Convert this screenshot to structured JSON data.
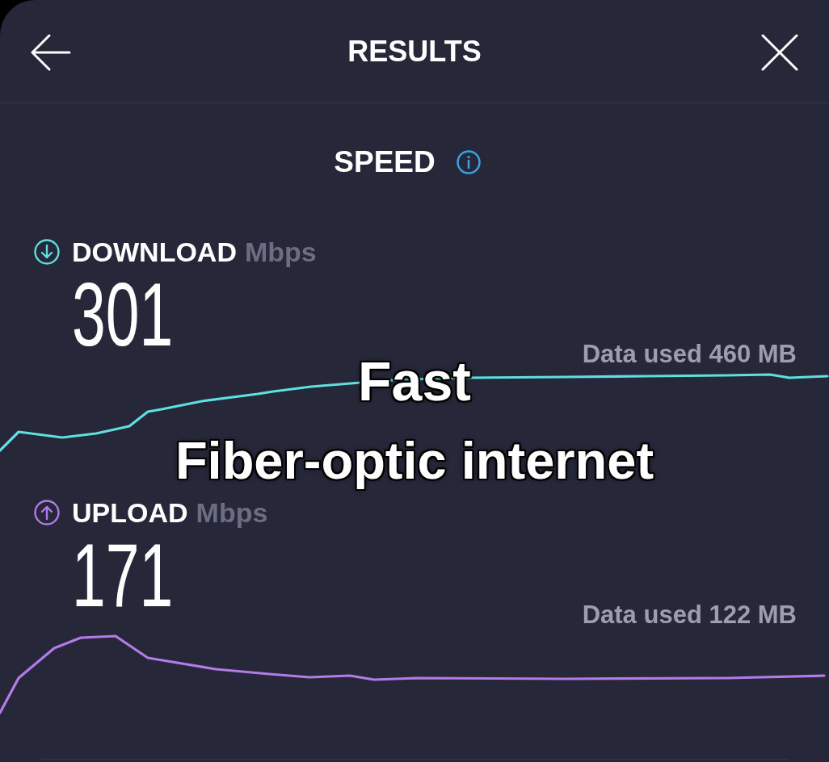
{
  "header": {
    "title": "RESULTS"
  },
  "section": {
    "title": "SPEED"
  },
  "metrics": [
    {
      "kind": "download",
      "label": "DOWNLOAD",
      "unit": "Mbps",
      "value": "301",
      "data_used": "Data used 460 MB",
      "color": "#5fdfe0"
    },
    {
      "kind": "upload",
      "label": "UPLOAD",
      "unit": "Mbps",
      "value": "171",
      "data_used": "Data used 122 MB",
      "color": "#b47be8"
    }
  ],
  "caption": {
    "lines": [
      "Fast",
      "Fiber-optic internet"
    ]
  }
}
